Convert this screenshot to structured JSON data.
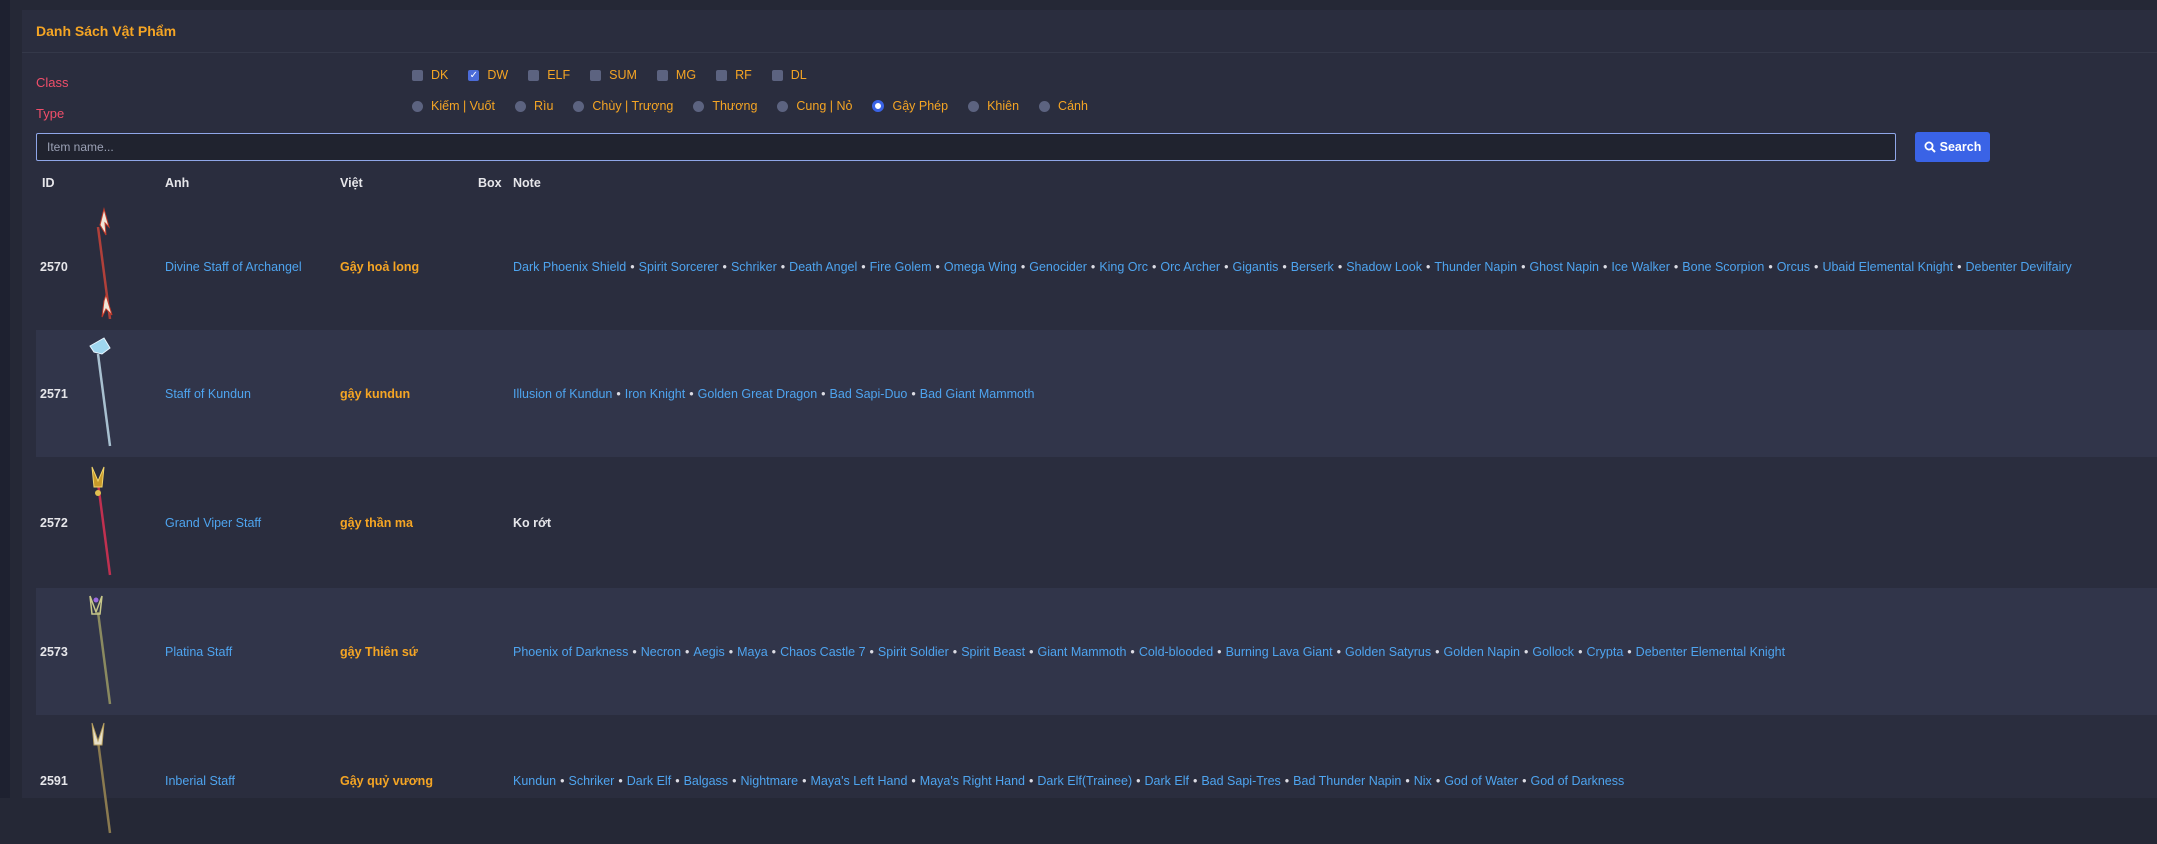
{
  "panel": {
    "title": "Danh Sách Vật Phẩm"
  },
  "filters": {
    "class_label": "Class",
    "type_label": "Type",
    "classes": [
      {
        "label": "DK",
        "checked": false
      },
      {
        "label": "DW",
        "checked": true
      },
      {
        "label": "ELF",
        "checked": false
      },
      {
        "label": "SUM",
        "checked": false
      },
      {
        "label": "MG",
        "checked": false
      },
      {
        "label": "RF",
        "checked": false
      },
      {
        "label": "DL",
        "checked": false
      }
    ],
    "types": [
      {
        "label": "Kiếm | Vuốt",
        "selected": false
      },
      {
        "label": "Rìu",
        "selected": false
      },
      {
        "label": "Chùy | Trượng",
        "selected": false
      },
      {
        "label": "Thương",
        "selected": false
      },
      {
        "label": "Cung | Nỏ",
        "selected": false
      },
      {
        "label": "Gậy Phép",
        "selected": true
      },
      {
        "label": "Khiên",
        "selected": false
      },
      {
        "label": "Cánh",
        "selected": false
      }
    ]
  },
  "search": {
    "placeholder": "Item name...",
    "value": "",
    "button_label": "Search",
    "button_icon": "search-icon"
  },
  "table": {
    "headers": {
      "id": "ID",
      "image": "Anh",
      "viet": "Việt",
      "box": "Box",
      "note": "Note"
    },
    "rows": [
      {
        "id": "2570",
        "name": "Divine Staff of Archangel",
        "viet": "Gậy hoả long",
        "box": "",
        "image": "divine-staff-icon",
        "note_links": [
          "Dark Phoenix Shield",
          "Spirit Sorcerer",
          "Schriker",
          "Death Angel",
          "Fire Golem",
          "Omega Wing",
          "Genocider",
          "King Orc",
          "Orc Archer",
          "Gigantis",
          "Berserk",
          "Shadow Look",
          "Thunder Napin",
          "Ghost Napin",
          "Ice Walker",
          "Bone Scorpion",
          "Orcus",
          "Ubaid Elemental Knight",
          "Debenter Devilfairy"
        ],
        "note_text": ""
      },
      {
        "id": "2571",
        "name": "Staff of Kundun",
        "viet": "gậy kundun",
        "box": "",
        "image": "kundun-staff-icon",
        "note_links": [
          "Illusion of Kundun",
          "Iron Knight",
          "Golden Great Dragon",
          "Bad Sapi-Duo",
          "Bad Giant Mammoth"
        ],
        "note_text": ""
      },
      {
        "id": "2572",
        "name": "Grand Viper Staff",
        "viet": "gậy thần ma",
        "box": "",
        "image": "viper-staff-icon",
        "note_links": [],
        "note_text": "Ko rớt"
      },
      {
        "id": "2573",
        "name": "Platina Staff",
        "viet": "gậy Thiên sứ",
        "box": "",
        "image": "platina-staff-icon",
        "note_links": [
          "Phoenix of Darkness",
          "Necron",
          "Aegis",
          "Maya",
          "Chaos Castle 7",
          "Spirit Soldier",
          "Spirit Beast",
          "Giant Mammoth",
          "Cold-blooded",
          "Burning Lava Giant",
          "Golden Satyrus",
          "Golden Napin",
          "Gollock",
          "Crypta",
          "Debenter Elemental Knight"
        ],
        "note_text": ""
      },
      {
        "id": "2591",
        "name": "Inberial Staff",
        "viet": "Gậy quỷ vương",
        "box": "",
        "image": "inberial-staff-icon",
        "note_links": [
          "Kundun",
          "Schriker",
          "Dark Elf",
          "Balgass",
          "Nightmare",
          "Maya's Left Hand",
          "Maya's Right Hand",
          "Dark Elf(Trainee)",
          "Dark Elf",
          "Bad Sapi-Tres",
          "Bad Thunder Napin",
          "Nix",
          "God of Water",
          "God of Darkness"
        ],
        "note_text": ""
      }
    ]
  },
  "colors": {
    "accent_orange": "#f5a524",
    "link_blue": "#4ea4ef",
    "label_pink": "#f04e6a",
    "button_blue": "#3a63e6"
  }
}
